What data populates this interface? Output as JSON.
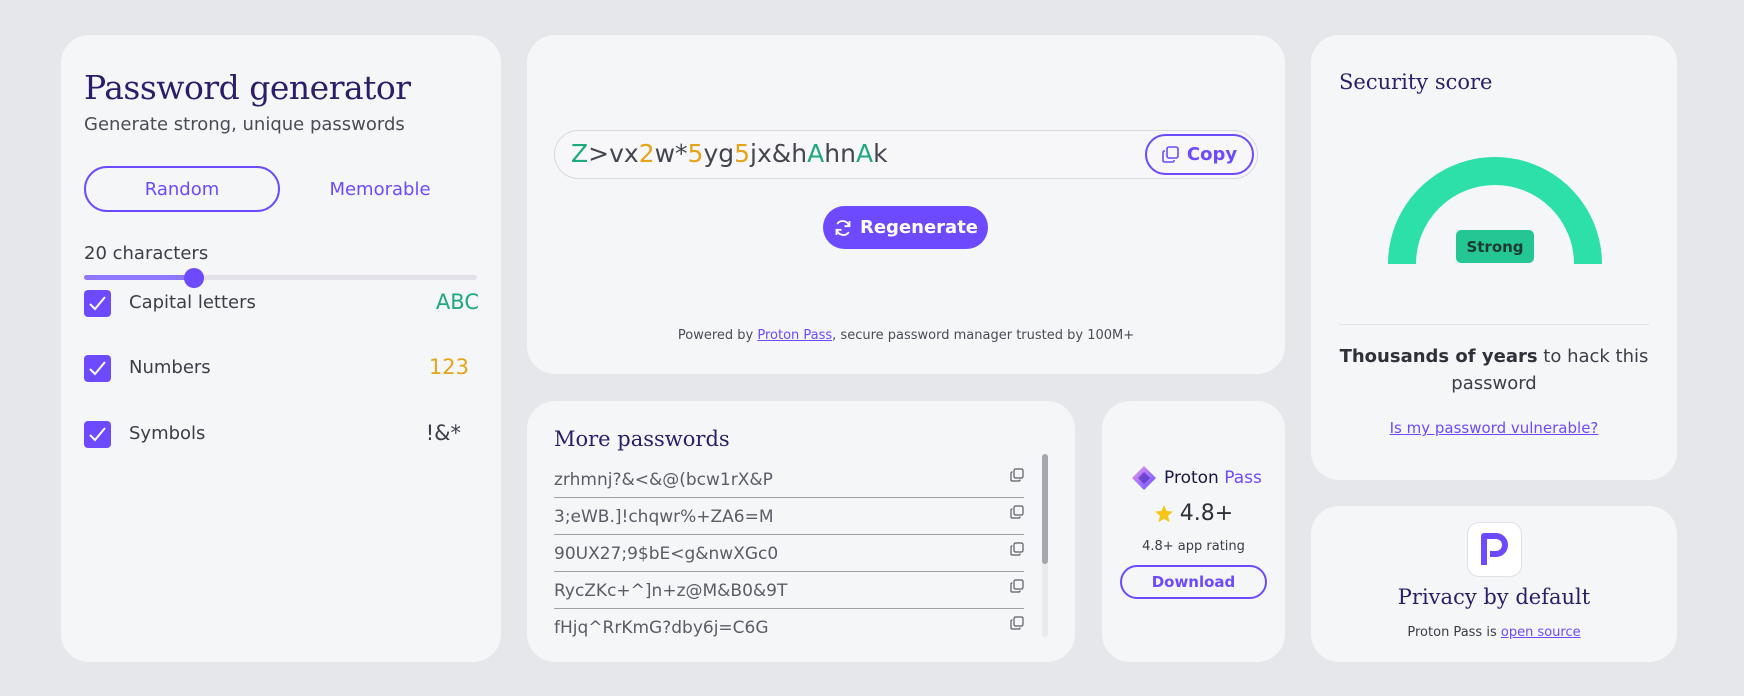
{
  "generator": {
    "title": "Password generator",
    "subtitle": "Generate strong, unique passwords",
    "modes": {
      "random": "Random",
      "memorable": "Memorable"
    },
    "active_mode": "random",
    "length_label": "20 characters",
    "length_value": 20,
    "length_fraction": 0.28,
    "options": [
      {
        "label": "Capital letters",
        "sample": "ABC",
        "checked": true,
        "sample_color": "#1ea97c"
      },
      {
        "label": "Numbers",
        "sample": "123",
        "checked": true,
        "sample_color": "#e5a419"
      },
      {
        "label": "Symbols",
        "sample": "!&*",
        "checked": true,
        "sample_color": "#3b3d47"
      }
    ]
  },
  "password": {
    "value": "Z>vx2w*5yg5jx&hAhnAk",
    "copy_label": "Copy",
    "regenerate_label": "Regenerate",
    "powered_prefix": "Powered by ",
    "powered_link": "Proton Pass",
    "powered_suffix": ", secure password manager trusted by 100M+"
  },
  "security": {
    "title": "Security score",
    "strength": "Strong",
    "gauge_color": "#2ddfa8",
    "hack_bold": "Thousands of years",
    "hack_rest": " to hack this password",
    "vulnerable_link": "Is my password vulnerable?"
  },
  "more_passwords": {
    "title": "More passwords",
    "items": [
      "zrhmnj?&<&@(bcw1rX&P",
      "3;eWB.]!chqwr%+ZA6=M",
      "90UX27;9$bE<g&nwXGc0",
      "RycZKc+^]n+z@M&B0&9T",
      "fHjq^RrKmG?dby6j=C6G"
    ]
  },
  "rating": {
    "brand_prefix": "Proton ",
    "brand_suffix": "Pass",
    "score": "4.8+",
    "label": "4.8+ app rating",
    "download_label": "Download",
    "star_color": "#f5c518"
  },
  "privacy": {
    "title": "Privacy by default",
    "oss_prefix": "Proton Pass is ",
    "oss_link": "open source"
  },
  "colors": {
    "accent": "#6d4aff",
    "uppercase": "#1ea97c",
    "digit": "#e5a419"
  }
}
